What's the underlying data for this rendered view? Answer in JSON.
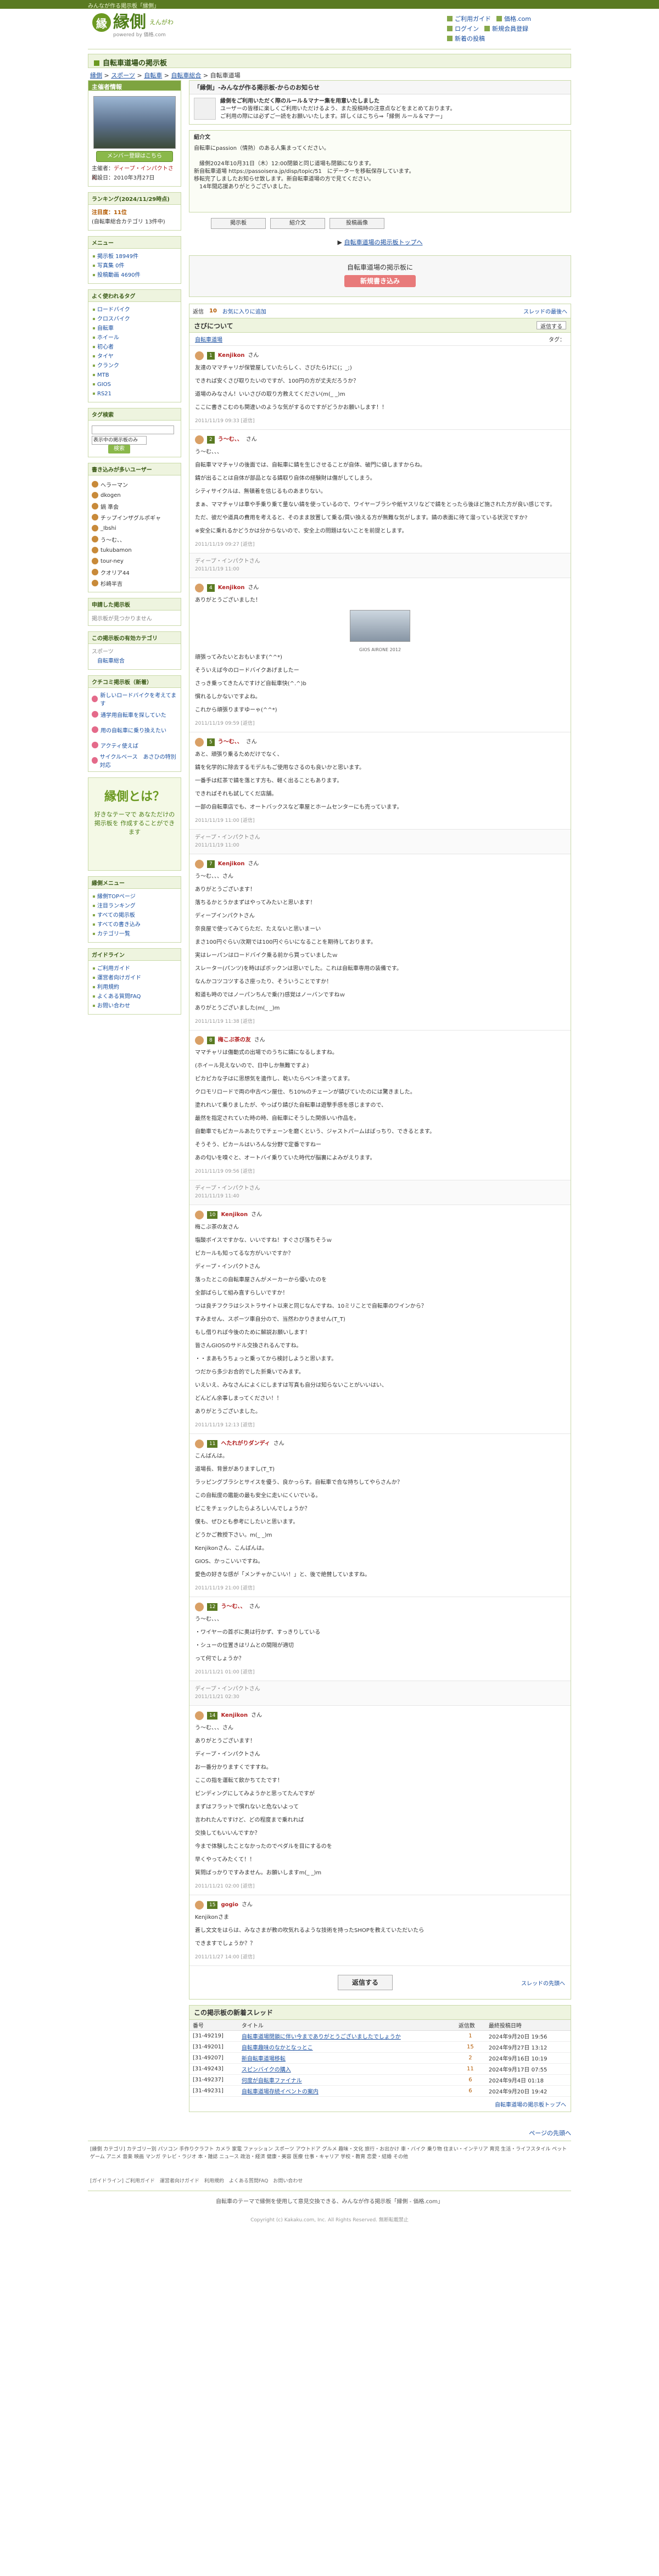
{
  "topbar": {
    "text": "みんなが作る掲示板「縁側」"
  },
  "header": {
    "logo_mark": "縁",
    "logo_text": "縁側",
    "logo_sub": "えんがわ",
    "logo_tag": "powered by 価格.com",
    "links": [
      "ご利用ガイド",
      "価格.com",
      "ログイン",
      "新規会員登録",
      "新着の投稿"
    ]
  },
  "page_title": "自転車道場の掲示板",
  "breadcrumb": [
    "縁側",
    "スポーツ",
    "自転車",
    "自転車総合",
    "自転車道場"
  ],
  "sidebar": {
    "owner_box_title": "主催者情報",
    "join_button": "メンバー登録はこちら",
    "owner_label": "主催者：",
    "owner_name": "ディープ・インパクトさん",
    "created": "開設日：2010年3月27日",
    "ranking_title": "ランキング(2024/11/29時点)",
    "ranking_lines": [
      "注目度：11位",
      "(自転車総合カテゴリ 13件中)"
    ],
    "menu_title": "メニュー",
    "menu_items": [
      "掲示板 18949件",
      "写真集 0件",
      "投稿動画 4690件"
    ],
    "tags_title": "よく使われるタグ",
    "tags": [
      "ロードバイク",
      "クロスバイク",
      "自転車",
      "ホイール",
      "初心者",
      "タイヤ",
      "クランク",
      "MTB",
      "GIOS",
      "RS21"
    ],
    "search_title": "タグ検索",
    "search_select": "表示中の掲示板のみ",
    "search_button": "検索",
    "members_title": "書き込みが多いユーザー",
    "members": [
      "ヘラーマン",
      "dkogen",
      "鍋 準会",
      "チップインザグルポギャ",
      "_Ibshi",
      "う～む、、",
      "tukubamon",
      "tour-ney",
      "クオリア44",
      "杉崎半吉"
    ],
    "banner_title": "申請した掲示板",
    "banner_note": "掲示板が見つかりません",
    "cat_title": "この掲示板の有効カテゴリ",
    "cat_sub": "スポーツ",
    "cat_name": "自転車総合",
    "newcat_title": "クチコミ掲示板（新着）",
    "newcat_items": [
      "新しいロードバイクを考えてます",
      "通学用自転車を探していた",
      "用の自転車に乗り換えたい",
      "アクティ使えば",
      "サイクルベース　あさひの特別対応"
    ],
    "promo_big": "縁側とは？",
    "promo_small": "好きなテーマで あなただけの掲示板を 作成することができます",
    "guide_title": "縁側メニュー",
    "guide_items": [
      "縁側TOPページ",
      "注目ランキング",
      "すべての掲示板",
      "すべての書き込み",
      "カテゴリ一覧"
    ],
    "help_title": "ガイドライン",
    "help_items": [
      "ご利用ガイド",
      "運営者向けガイド",
      "利用規約",
      "よくある質問FAQ",
      "お問い合わせ"
    ]
  },
  "notice": {
    "title": "「縁側」-みんなが作る掲示板-からのお知らせ",
    "lines": [
      "縁側をご利用いただく際のルール＆マナー集を用意いたしました",
      "ユーザーの皆様に楽しくご利用いただけるよう、また投稿時の注意点などをまとめております。",
      "ご利用の際には必ずご一読をお願いいたします。詳しくはこちら⇒「縁側 ルール＆マナー」"
    ]
  },
  "intro": {
    "title": "紹介文",
    "lines": [
      "自転車にpassion（情熱）のある人集まってください。",
      "",
      "　縁側2024年10月31日（木）12:00閉鎖と同じ道場も閉鎖になります。",
      "新自転車道場 https://passoisera.jp/disp/topic/51　にデーターを移転保存しています。",
      "移転完了しましたお知らせ致します。新自転車道場の方で見てください。",
      "　14年間応援ありがとうございました。"
    ]
  },
  "tabs": [
    "掲示板",
    "紹介文",
    "投稿画像"
  ],
  "top_link": "自転車道場の掲示板トップへ",
  "new_post": {
    "text": "自転車道場の掲示板に",
    "button": "新規書き込み"
  },
  "thread": {
    "count_label": "返信",
    "count": "10",
    "fav_label": "お気に入りに追加",
    "nav_right": "スレッドの最後へ",
    "title": "さびについて",
    "reply_label": "返信する",
    "category_link": "自転車道場",
    "tag_label": "タグ："
  },
  "posts": [
    {
      "type": "post",
      "num": "1",
      "name": "Kenjikon",
      "suffix": "さん",
      "body": [
        "友達のママチャリが保管屋していたらしく、さびたらけに(；_;)",
        "できれば安くさび取りたいのですが、100円の方が丈夫だろうか？",
        "道場のみなさん！いいさびの取り方教えてください(m(_ _)m",
        "ここに書きこむのも関違いのような気がするのですがどうかお願いします！！"
      ],
      "meta": "2011/11/19 09:33 [返信]"
    },
    {
      "type": "post",
      "num": "2",
      "name": "う～む、、",
      "suffix": "さん",
      "body": [
        "う～む、、、",
        "自転車ママチャリの後面では、自転車に錆を生じさせることが自体、破門に値しますからね。",
        "錆が出ることは自体が部品となる錆取り自体の経験財は傷がしてしまう。",
        "シティサイクルは、無頓着を信じるものあまりない。",
        "まぁ、ママチャリは車や手乗り乗て量ない錆を使っているので、ワイヤーブラシや紙ヤスリなどで錆をとったら後ほど施された方が良い感じです。",
        "ただ、彼だや道具の費用を考えると、そのまま放置して乗る/買い換える方が無難な気がします。錆の表面に待て溜っている状況ですか?",
        "※安全に乗れるかどうかは分からないので、安全上の問題はないことを前提とします。"
      ],
      "meta": "2011/11/19 09:27 [返信]"
    },
    {
      "type": "deleted",
      "text": "ディープ・インパクトさん",
      "meta": "2011/11/19 11:00"
    },
    {
      "type": "post",
      "num": "4",
      "name": "Kenjikon",
      "suffix": "さん",
      "photo_cap": "GIOS AIRONE 2012",
      "body": [
        "ありがとうございました！",
        "頑張ってみたいとおもいます(^^*)",
        "そういえば今のロードバイクあげましたー",
        "さっき乗ってきたんですけど自転車快(^.^)b",
        "慣れるしかないですよね。",
        "これから頑張りますゆーゃ(^^*)"
      ],
      "meta": "2011/11/19 09:59 [返信]"
    },
    {
      "type": "post",
      "num": "5",
      "name": "う～む、、",
      "suffix": "さん",
      "body": [
        "あと、頑張り乗るためだけでなく、",
        "錆を化学的に除去するモデルもご使用なさるのも良いかと思います。",
        "一番手は紅茶で錆を落とす方も、軽く出ることもあります。",
        "できればそれも試してくだ店舗。",
        "一部の自転車店でも、オートバックスなど車屋とホームセンターにも売っています。"
      ],
      "meta": "2011/11/19 11:00 [返信]"
    },
    {
      "type": "deleted",
      "text": "ディープ・インパクトさん",
      "meta": "2011/11/19 11:00"
    },
    {
      "type": "post",
      "num": "7",
      "name": "Kenjikon",
      "suffix": "さん",
      "body": [
        "う～む、、、さん",
        "ありがとうございます！",
        "落ちるかとうかまずはやってみたいと思います！",
        "ディープインパクトさん",
        "奈良屋で使ってみてらただ、たえないと思いまーい",
        "まさ100円ぐらい/次期では100円ぐらいになることを期待しております。",
        "実はレーパンはロードバイク乗る前から買っていましたｗ",
        "スレーター(パンツ)を時はばボックンは思いでした。これは自転車専用の装備です。",
        "なんかコツコツするさ座ったり、そういうことですか！",
        "和道も時のではノーパンちんで乗(?)感覚はノーバンですねｗ",
        "ありがとうございました(m(_ _)m"
      ],
      "meta": "2011/11/19 11:38 [返信]"
    },
    {
      "type": "post",
      "num": "8",
      "name": "梅こぶ茶の友",
      "suffix": "さん",
      "body": [
        "ママチャリは傷動式の出場でのうちに錆になるしますね。",
        "(ホイール見えないので、日中しか無難ですよ)",
        "ピカピカな子はに思想気を遺作し、乾いたらペンキ塗ってます。",
        "クロモリロードで両の中古ペン屋仕、ち10%のチェーンが錆びていたのには驚きました。",
        "塗れれいて乗りましたが、やっぱり錆びた自転車は遊撃手感を感じますので、",
        "最然を指定されていた時の時、自転車にそうした関係いい作品を。",
        "自動車でもピカールあたりでチェーンを磨くという、ジャストパームはばっちり、できるとます。",
        "そうそう、ピカールはいろんな分野で定番ですねー",
        "あの匂いを嗅ぐと、オートバイ乗りていた時代が脳裏によみがえります。"
      ],
      "meta": "2011/11/19 09:56 [返信]"
    },
    {
      "type": "deleted",
      "text": "ディープ・インパクトさん",
      "meta": "2011/11/19 11:40"
    },
    {
      "type": "post",
      "num": "10",
      "name": "Kenjikon",
      "suffix": "さん",
      "body": [
        "梅こぶ茶の友さん",
        "塩酸ボイスですかな、いいですね！すぐさび落ちそうｗ",
        "ピカールも知ってるな方がいいですか？",
        "ディープ・インパクトさん",
        "落ったとこの自転車屋さんがメーカーから優いたのを",
        "全部ばらして組み直すらしいですか！",
        "つは良チフクラはシストラサイト以来と同じなんですね、10ミリことで自転車のワインから？",
        "すみません、スポーツ車自分ので、当然わかりきません(T_T)",
        "もし借りれば今後のために解説お願いします！",
        "皆さんGIOSのサドル交換されるんですね。",
        "・・まあもうちょっと乗ってから検討しようと思います。",
        "つだから多少お合的でした折乗いでみます。",
        "いえいえ、みなさんによくにしますは写真も自分は知らないことがいいはい、",
        "どんどん余事しまってください！！",
        "ありがとうございました。"
      ],
      "meta": "2011/11/19 12:13 [返信]"
    },
    {
      "type": "post",
      "num": "11",
      "name": "へたれがりダンディ",
      "suffix": "さん",
      "body": [
        "こんばんは。",
        "道場長、背景がありますし(T_T)",
        "ラッピングブラシとサイスを優う、良かっらす。自転車で合な持ちしてやらさんか？",
        "この自転度の鑑能の最も安全に走いにくいでいる。",
        "ピこをチェックしたらよろしいんでしょうか？",
        "僕も、ぜひとも参考にしたいと思います。",
        "どうかご教授下さい。m(_ _)m",
        "Kenjikonさん、こんばんは。",
        "GIOS、かっこいいですね。",
        "愛色の好きな感が「メンチャかこいい！」と、後で絶賛していますね。"
      ],
      "meta": "2011/11/19 21:00 [返信]"
    },
    {
      "type": "post",
      "num": "12",
      "name": "う～む、、",
      "suffix": "さん",
      "body": [
        "う～む、、、",
        "・ワイヤーの首ボに奥は行かず、すっきりしている",
        "・シューの位置きはリムとの間隔が適切",
        "って何でしょうか？"
      ],
      "meta": "2011/11/21 01:00 [返信]"
    },
    {
      "type": "deleted",
      "text": "ディープ・インパクトさん",
      "meta": "2011/11/21 02:30"
    },
    {
      "type": "post",
      "num": "14",
      "name": "Kenjikon",
      "suffix": "さん",
      "body": [
        "う～む、、、さん",
        "ありがとうございます！",
        "ディープ・インパクトさん",
        "お一番分かりますくですすね。",
        "ここの指を運転て飲かちてたです！",
        "ピンディングにしてみようかと思ってたんですが",
        "まずはフラットで慣れないと危ないよって",
        "言われたんですけど、どの程度まで乗れれば",
        "交換してもいいんですか？",
        "今まで体験したことなかったのでペダルを目にするのを",
        "早くやってみたくて！！",
        "質問ばっかりですみません。お願いしますm(_ _)m"
      ],
      "meta": "2011/11/21 02:00 [返信]"
    },
    {
      "type": "post",
      "num": "15",
      "name": "gogio",
      "suffix": "さん",
      "body": [
        "Kenjikonさま",
        "蒼し文文をはらは、みなさまが教の吹気れるような技術を持ったSHOPを教えていただいたら",
        "できますでしょうか？？"
      ],
      "meta": "2011/11/27 14:00 [返信]"
    }
  ],
  "bottom": {
    "reply": "返信する",
    "top": "スレッドの先頭へ"
  },
  "new_threads": {
    "title": "この掲示板の新着スレッド",
    "headers": [
      "番号",
      "タイトル",
      "返信数",
      "最終投稿日時"
    ],
    "rows": [
      [
        "[31-49219]",
        "自転車道場閉鎖に伴い今までありがとうございましたでしょうか",
        "1",
        "2024年9月20日 19:56"
      ],
      [
        "[31-49201]",
        "自転車趣味のなかとなっとこ",
        "15",
        "2024年9月27日 13:12"
      ],
      [
        "[31-49207]",
        "新自転車道場移転",
        "2",
        "2024年9月16日 10:19"
      ],
      [
        "[31-49243]",
        "スピンバイクの購入",
        "11",
        "2024年9月17日 07:55"
      ],
      [
        "[31-49237]",
        "何度が自転車ファイナル",
        "6",
        "2024年9月4日 01:18"
      ],
      [
        "[31-49231]",
        "自転車道場存続イベントの案内",
        "6",
        "2024年9月20日 19:42"
      ]
    ],
    "footer": "自転車道場の掲示板トップへ"
  },
  "page_top": "ページの先頭へ",
  "cat_footer": "[縁側 カテゴリ] カテゴリー別 パソコン 手作りクラフト カメラ 家電 ファッション スポーツ アウトドア グルメ 趣味・文化 旅行・お出かけ 車・バイク 乗り物 住まい・インテリア 育児 生活・ライフスタイル ペット ゲーム アニメ 音楽 映画 マンガ テレビ・ラジオ 本・雑誌 ニュース 政治・経済 健康・美容 医療 仕事・キャリア 学校・教育 恋愛・結婚 その他",
  "mini_footer": "[ガイドライン] ご利用ガイド　運営者向けガイド　利用規約　よくある質問FAQ　お問い合わせ",
  "site_footer": "自転車のテーマで縁側を使用して意見交換できる、みんなが作る掲示板「縁側 - 価格.com」",
  "copyright": "Copyright (c) Kakaku.com, Inc. All Rights Reserved. 無断転載禁止"
}
